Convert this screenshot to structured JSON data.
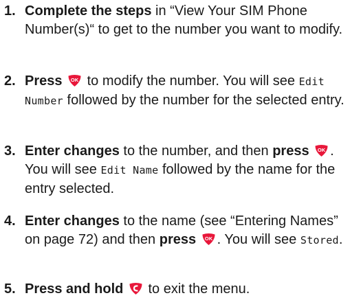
{
  "steps": [
    {
      "number": "1.",
      "bold": "Complete the steps",
      "text": " in “View Your SIM Phone Number(s)“ to get to the number you want to modify."
    },
    {
      "number": "2.",
      "bold": "Press",
      "text_a": " to modify the number. You will see ",
      "lcd": "Edit Number",
      "text_b": " followed by the number for the selected entry."
    },
    {
      "number": "3.",
      "bold": "Enter changes",
      "text_a": " to the number, and then ",
      "bold_b": "press",
      "text_b": ". You will see ",
      "lcd": "Edit Name",
      "text_c": " followed by the name for the entry selected."
    },
    {
      "number": "4.",
      "bold": "Enter changes",
      "text_a": " to the name (see “Entering Names” on page 72) and then ",
      "bold_b": "press",
      "text_b": ". You will see ",
      "lcd": "Stored",
      "text_c": "."
    },
    {
      "number": "5.",
      "bold": "Press and hold",
      "text": " to exit the menu."
    }
  ],
  "icons": {
    "ok_button": {
      "label": "OK",
      "color": "#e8173a"
    },
    "end_button": {
      "color": "#e8173a"
    }
  }
}
